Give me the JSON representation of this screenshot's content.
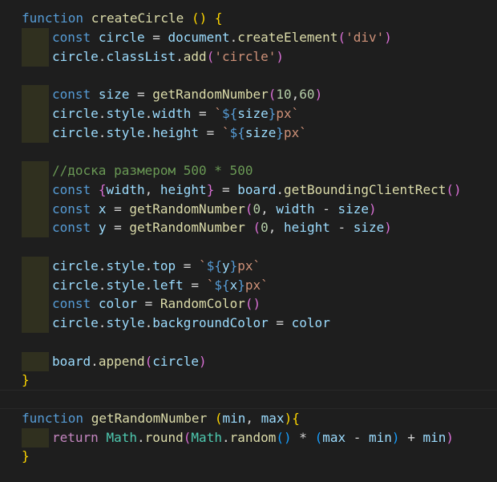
{
  "editor": {
    "lines": [
      {
        "indent": false,
        "tokens": [
          [
            "kw",
            "function"
          ],
          [
            "op",
            " "
          ],
          [
            "fn",
            "createCircle"
          ],
          [
            "op",
            " "
          ],
          [
            "b1",
            "()"
          ],
          [
            "op",
            " "
          ],
          [
            "b1",
            "{"
          ]
        ]
      },
      {
        "indent": true,
        "tokens": [
          [
            "kw",
            "const"
          ],
          [
            "op",
            " "
          ],
          [
            "var",
            "circle"
          ],
          [
            "op",
            " = "
          ],
          [
            "var",
            "document"
          ],
          [
            "op",
            "."
          ],
          [
            "fn",
            "createElement"
          ],
          [
            "b2",
            "("
          ],
          [
            "str",
            "'div'"
          ],
          [
            "b2",
            ")"
          ]
        ]
      },
      {
        "indent": true,
        "tokens": [
          [
            "var",
            "circle"
          ],
          [
            "op",
            "."
          ],
          [
            "var",
            "classList"
          ],
          [
            "op",
            "."
          ],
          [
            "fn",
            "add"
          ],
          [
            "b2",
            "("
          ],
          [
            "str",
            "'circle'"
          ],
          [
            "b2",
            ")"
          ]
        ]
      },
      {
        "indent": false,
        "tokens": []
      },
      {
        "indent": true,
        "tokens": [
          [
            "kw",
            "const"
          ],
          [
            "op",
            " "
          ],
          [
            "var",
            "size"
          ],
          [
            "op",
            " = "
          ],
          [
            "fn",
            "getRandomNumber"
          ],
          [
            "b2",
            "("
          ],
          [
            "num",
            "10"
          ],
          [
            "op",
            ","
          ],
          [
            "num",
            "60"
          ],
          [
            "b2",
            ")"
          ]
        ]
      },
      {
        "indent": true,
        "tokens": [
          [
            "var",
            "circle"
          ],
          [
            "op",
            "."
          ],
          [
            "var",
            "style"
          ],
          [
            "op",
            "."
          ],
          [
            "var",
            "width"
          ],
          [
            "op",
            " = "
          ],
          [
            "str",
            "`"
          ],
          [
            "kw",
            "${"
          ],
          [
            "var",
            "size"
          ],
          [
            "kw",
            "}"
          ],
          [
            "str",
            "px`"
          ]
        ]
      },
      {
        "indent": true,
        "tokens": [
          [
            "var",
            "circle"
          ],
          [
            "op",
            "."
          ],
          [
            "var",
            "style"
          ],
          [
            "op",
            "."
          ],
          [
            "var",
            "height"
          ],
          [
            "op",
            " = "
          ],
          [
            "str",
            "`"
          ],
          [
            "kw",
            "${"
          ],
          [
            "var",
            "size"
          ],
          [
            "kw",
            "}"
          ],
          [
            "str",
            "px`"
          ]
        ]
      },
      {
        "indent": false,
        "tokens": []
      },
      {
        "indent": true,
        "tokens": [
          [
            "cmt",
            "//доска размером 500 * 500"
          ]
        ]
      },
      {
        "indent": true,
        "tokens": [
          [
            "kw",
            "const"
          ],
          [
            "op",
            " "
          ],
          [
            "b2",
            "{"
          ],
          [
            "var",
            "width"
          ],
          [
            "op",
            ", "
          ],
          [
            "var",
            "height"
          ],
          [
            "b2",
            "}"
          ],
          [
            "op",
            " = "
          ],
          [
            "var",
            "board"
          ],
          [
            "op",
            "."
          ],
          [
            "fn",
            "getBoundingClientRect"
          ],
          [
            "b2",
            "()"
          ]
        ]
      },
      {
        "indent": true,
        "tokens": [
          [
            "kw",
            "const"
          ],
          [
            "op",
            " "
          ],
          [
            "var",
            "x"
          ],
          [
            "op",
            " = "
          ],
          [
            "fn",
            "getRandomNumber"
          ],
          [
            "b2",
            "("
          ],
          [
            "num",
            "0"
          ],
          [
            "op",
            ", "
          ],
          [
            "var",
            "width"
          ],
          [
            "op",
            " - "
          ],
          [
            "var",
            "size"
          ],
          [
            "b2",
            ")"
          ]
        ]
      },
      {
        "indent": true,
        "tokens": [
          [
            "kw",
            "const"
          ],
          [
            "op",
            " "
          ],
          [
            "var",
            "y"
          ],
          [
            "op",
            " = "
          ],
          [
            "fn",
            "getRandomNumber"
          ],
          [
            "op",
            " "
          ],
          [
            "b2",
            "("
          ],
          [
            "num",
            "0"
          ],
          [
            "op",
            ", "
          ],
          [
            "var",
            "height"
          ],
          [
            "op",
            " - "
          ],
          [
            "var",
            "size"
          ],
          [
            "b2",
            ")"
          ]
        ]
      },
      {
        "indent": false,
        "tokens": []
      },
      {
        "indent": true,
        "tokens": [
          [
            "var",
            "circle"
          ],
          [
            "op",
            "."
          ],
          [
            "var",
            "style"
          ],
          [
            "op",
            "."
          ],
          [
            "var",
            "top"
          ],
          [
            "op",
            " = "
          ],
          [
            "str",
            "`"
          ],
          [
            "kw",
            "${"
          ],
          [
            "var",
            "y"
          ],
          [
            "kw",
            "}"
          ],
          [
            "str",
            "px`"
          ]
        ]
      },
      {
        "indent": true,
        "tokens": [
          [
            "var",
            "circle"
          ],
          [
            "op",
            "."
          ],
          [
            "var",
            "style"
          ],
          [
            "op",
            "."
          ],
          [
            "var",
            "left"
          ],
          [
            "op",
            " = "
          ],
          [
            "str",
            "`"
          ],
          [
            "kw",
            "${"
          ],
          [
            "var",
            "x"
          ],
          [
            "kw",
            "}"
          ],
          [
            "str",
            "px`"
          ]
        ]
      },
      {
        "indent": true,
        "tokens": [
          [
            "kw",
            "const"
          ],
          [
            "op",
            " "
          ],
          [
            "var",
            "color"
          ],
          [
            "op",
            " = "
          ],
          [
            "fn",
            "RandomColor"
          ],
          [
            "b2",
            "()"
          ]
        ]
      },
      {
        "indent": true,
        "tokens": [
          [
            "var",
            "circle"
          ],
          [
            "op",
            "."
          ],
          [
            "var",
            "style"
          ],
          [
            "op",
            "."
          ],
          [
            "var",
            "backgroundColor"
          ],
          [
            "op",
            " = "
          ],
          [
            "var",
            "color"
          ]
        ]
      },
      {
        "indent": false,
        "tokens": []
      },
      {
        "indent": true,
        "tokens": [
          [
            "var",
            "board"
          ],
          [
            "op",
            "."
          ],
          [
            "fn",
            "append"
          ],
          [
            "b2",
            "("
          ],
          [
            "var",
            "circle"
          ],
          [
            "b2",
            ")"
          ]
        ]
      },
      {
        "indent": false,
        "tokens": [
          [
            "b1",
            "}"
          ]
        ]
      },
      {
        "indent": false,
        "current": true,
        "tokens": []
      },
      {
        "indent": false,
        "tokens": [
          [
            "kw",
            "function"
          ],
          [
            "op",
            " "
          ],
          [
            "fn",
            "getRandomNumber"
          ],
          [
            "op",
            " "
          ],
          [
            "b1",
            "("
          ],
          [
            "var",
            "min"
          ],
          [
            "op",
            ", "
          ],
          [
            "var",
            "max"
          ],
          [
            "b1",
            ")"
          ],
          [
            "b1",
            "{"
          ]
        ]
      },
      {
        "indent": true,
        "tokens": [
          [
            "ctl",
            "return"
          ],
          [
            "op",
            " "
          ],
          [
            "cls",
            "Math"
          ],
          [
            "op",
            "."
          ],
          [
            "fn",
            "round"
          ],
          [
            "b2",
            "("
          ],
          [
            "cls",
            "Math"
          ],
          [
            "op",
            "."
          ],
          [
            "fn",
            "random"
          ],
          [
            "b3",
            "()"
          ],
          [
            "op",
            " * "
          ],
          [
            "b3",
            "("
          ],
          [
            "var",
            "max"
          ],
          [
            "op",
            " - "
          ],
          [
            "var",
            "min"
          ],
          [
            "b3",
            ")"
          ],
          [
            "op",
            " + "
          ],
          [
            "var",
            "min"
          ],
          [
            "b2",
            ")"
          ]
        ]
      },
      {
        "indent": false,
        "tokens": [
          [
            "b1",
            "}"
          ]
        ]
      }
    ]
  }
}
